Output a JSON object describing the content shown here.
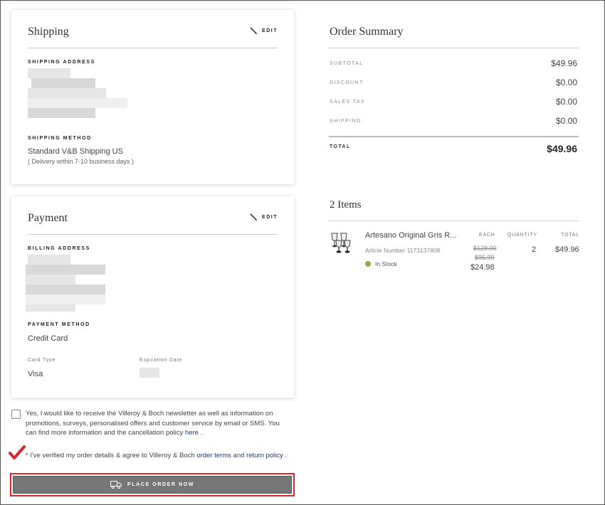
{
  "shipping": {
    "title": "Shipping",
    "edit_label": "EDIT",
    "address_label": "SHIPPING ADDRESS",
    "method_label": "SHIPPING METHOD",
    "method_value": "Standard V&B Shipping US",
    "method_note": "( Delivery within 7-10 business days )"
  },
  "payment": {
    "title": "Payment",
    "edit_label": "EDIT",
    "billing_label": "BILLING ADDRESS",
    "method_label": "PAYMENT METHOD",
    "method_value": "Credit Card",
    "card_type_label": "Card Type",
    "card_type_value": "Visa",
    "expiration_label": "Expiration Date"
  },
  "summary": {
    "title": "Order Summary",
    "rows": [
      {
        "label": "SUBTOTAL",
        "value": "$49.96"
      },
      {
        "label": "DISCOUNT",
        "value": "$0.00"
      },
      {
        "label": "SALES TAX",
        "value": "$0.00"
      },
      {
        "label": "SHIPPING",
        "value": "$0.00"
      }
    ],
    "total_label": "TOTAL",
    "total_value": "$49.96"
  },
  "items": {
    "title": "2 Items",
    "headers": {
      "each": "EACH",
      "quantity": "QUANTITY",
      "total": "TOTAL"
    },
    "list": [
      {
        "name": "Artesano Original Gris R...",
        "article": "Article Number 1173137808",
        "stock": "In Stock",
        "price_original_1": "$128.00",
        "price_original_2": "$95.99",
        "price_each": "$24.98",
        "quantity": "2",
        "total": "$49.96"
      }
    ]
  },
  "consent": {
    "newsletter_text": "Yes, I would like to receive the Villeroy & Boch newsletter as well as information on promotions, surveys, personalised offers and customer service by email or SMS. You can find more information and the cancellation policy ",
    "newsletter_link": "here",
    "newsletter_end": " .",
    "terms_prefix": "* I've verified my order details & agree to Villeroy & Boch ",
    "terms_link": "order terms",
    "terms_and": " and ",
    "return_link": "return policy",
    "terms_end": " ."
  },
  "place_order": {
    "label": "PLACE ORDER NOW"
  },
  "colors": {
    "accent_red": "#d9262b",
    "stock_green": "#9aa64a",
    "button_gray": "#767676",
    "link_blue": "#1f3a6b"
  }
}
